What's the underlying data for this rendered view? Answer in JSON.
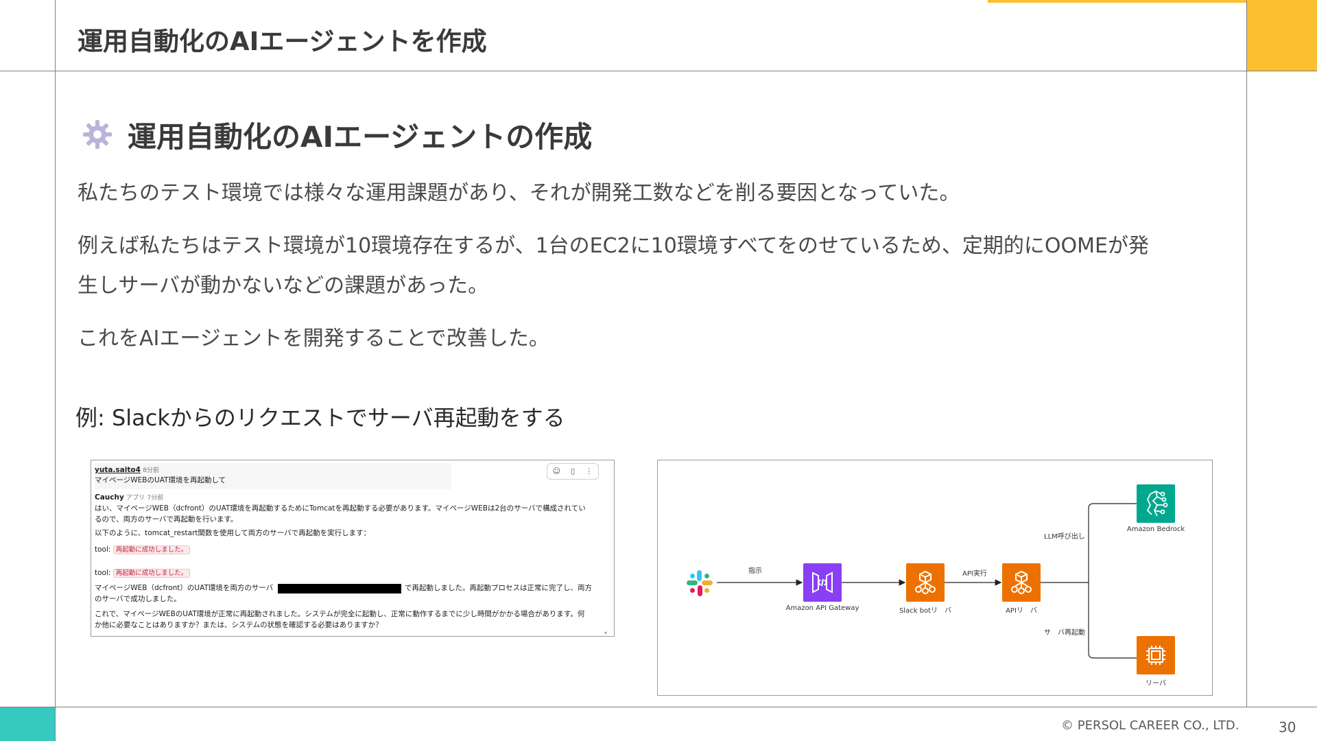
{
  "header": {
    "title": "運用自動化のAIエージェントを作成"
  },
  "section": {
    "title": "運用自動化のAIエージェントの作成",
    "icon": "gear-icon"
  },
  "body": {
    "p1": "私たちのテスト環境では様々な運用課題があり、それが開発工数などを削る要因となっていた。",
    "p2_line1": "例えば私たちはテスト環境が10環境存在するが、1台のEC2に10環境すべてをのせているため、定期的にOOMEが発",
    "p2_line2": "生しサーバが動かないなどの課題があった。",
    "p3": "これをAIエージェントを開発することで改善した。"
  },
  "example": {
    "caption": "例: Slackからのリクエストでサーバ再起動をする"
  },
  "slack": {
    "user": "yuta.saito4",
    "user_time": "8分前",
    "user_message": "マイページWEBのUAT環境を再起動して",
    "bot_name": "Cauchy",
    "bot_badge": "アプリ",
    "bot_time": "7分前",
    "bot_line1": "はい、マイページWEB（dcfront）のUAT環境を再起動するためにTomcatを再起動する必要があります。マイページWEBは2台のサーバで構成されてい",
    "bot_line2": "るので、両方のサーバで再起動を行います。",
    "bot_line3": "以下のように、tomcat_restart関数を使用して両方のサーバで再起動を実行します：",
    "tool_label": "tool:",
    "tool_result": "再起動に成功しました。",
    "result_line1_a": "マイページWEB（dcfront）のUAT環境を両方のサーバ",
    "result_line1_b": "で再起動しました。再起動プロセスは正常に完了し、両方",
    "result_line2": "のサーバで成功しました。",
    "closing_line1": "これで、マイページWEBのUAT環境が正常に再起動されました。システムが完全に起動し、正常に動作するまでに少し時間がかかる場合があります。何",
    "closing_line2": "か他に必要なことはありますか？または、システムの状態を確認する必要はありますか？"
  },
  "diagram": {
    "nodes": {
      "slack": "",
      "gateway": "Amazon API Gateway",
      "slack_bot": "Slack botリ　バ",
      "api": "APIリ　バ",
      "bedrock": "Amazon Bedrock",
      "server": "リーバ"
    },
    "edges": {
      "instruct": "指示",
      "api_exec": "API実行",
      "llm_call": "LLM呼び出し",
      "server_restart": "サ　バ再起動"
    },
    "colors": {
      "gateway": "#8a3ff5",
      "compute": "#ed7100",
      "bedrock": "#01a88d"
    }
  },
  "footer": {
    "copyright": "© PERSOL CAREER CO., LTD.",
    "page": "30"
  },
  "colors": {
    "accent_yellow": "#fbbf2f",
    "accent_teal": "#35c9c0"
  }
}
